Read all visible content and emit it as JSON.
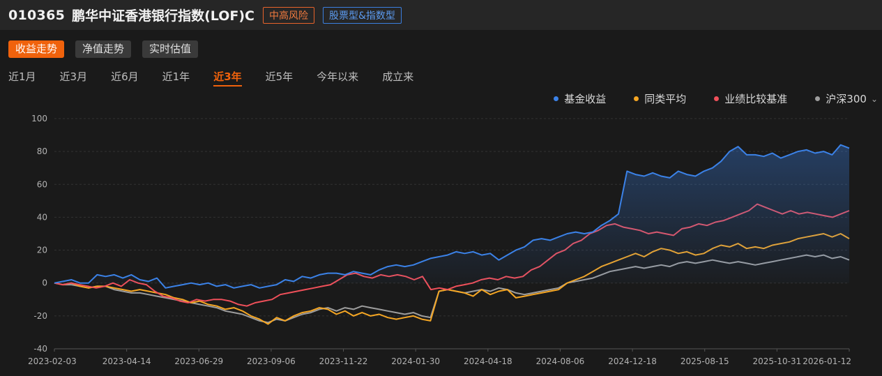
{
  "header": {
    "fund_code": "010365",
    "fund_name": "鹏华中证香港银行指数(LOF)C",
    "risk_tag": "中高风险",
    "type_tag": "股票型&指数型"
  },
  "mode_tabs": [
    {
      "label": "收益走势",
      "active": true
    },
    {
      "label": "净值走势",
      "active": false
    },
    {
      "label": "实时估值",
      "active": false
    }
  ],
  "range_tabs": [
    {
      "label": "近1月",
      "active": false
    },
    {
      "label": "近3月",
      "active": false
    },
    {
      "label": "近6月",
      "active": false
    },
    {
      "label": "近1年",
      "active": false
    },
    {
      "label": "近3年",
      "active": true
    },
    {
      "label": "近5年",
      "active": false
    },
    {
      "label": "今年以来",
      "active": false
    },
    {
      "label": "成立来",
      "active": false
    }
  ],
  "legend": [
    {
      "name": "基金收益",
      "color": "#3b82e8"
    },
    {
      "name": "同类平均",
      "color": "#f5a623"
    },
    {
      "name": "业绩比较基准",
      "color": "#f0505a"
    },
    {
      "name": "沪深300",
      "color": "#9e9e9e",
      "dropdown_icon": "chevron-down-icon"
    }
  ],
  "chart_data": {
    "type": "line",
    "x_tick_labels": [
      "2023-02-03",
      "2023-04-14",
      "2023-06-29",
      "2023-09-06",
      "2023-11-22",
      "2024-01-30",
      "2024-04-18",
      "2024-08-06",
      "2024-12-18",
      "2025-08-15",
      "2025-10-31",
      "2026-01-12"
    ],
    "ylim": [
      -40,
      100
    ],
    "y_ticks": [
      -40,
      -20,
      0,
      20,
      40,
      60,
      80,
      100
    ],
    "grid": true,
    "legend_position": "top-right",
    "series": [
      {
        "name": "基金收益",
        "color": "#3b82e8",
        "area_fill": true,
        "values": [
          0,
          1,
          2,
          0,
          0,
          5,
          4,
          5,
          3,
          5,
          2,
          1,
          3,
          -3,
          -2,
          -1,
          0,
          -1,
          0,
          -2,
          -1,
          -3,
          -2,
          -1,
          -3,
          -2,
          -1,
          2,
          1,
          4,
          3,
          5,
          6,
          6,
          5,
          7,
          6,
          5,
          8,
          10,
          11,
          10,
          11,
          13,
          15,
          16,
          17,
          19,
          18,
          19,
          17,
          18,
          14,
          17,
          20,
          22,
          26,
          27,
          26,
          28,
          30,
          31,
          30,
          31,
          35,
          38,
          42,
          68,
          66,
          65,
          67,
          65,
          64,
          68,
          66,
          65,
          68,
          70,
          74,
          80,
          83,
          78,
          78,
          77,
          79,
          76,
          78,
          80,
          81,
          79,
          80,
          78,
          84,
          82
        ]
      },
      {
        "name": "同类平均",
        "color": "#f5a623",
        "values": [
          0,
          -1,
          0,
          -2,
          -3,
          -2,
          -2,
          -3,
          -4,
          -5,
          -4,
          -5,
          -6,
          -7,
          -9,
          -10,
          -12,
          -11,
          -13,
          -14,
          -16,
          -15,
          -17,
          -20,
          -22,
          -25,
          -21,
          -23,
          -20,
          -18,
          -17,
          -15,
          -16,
          -19,
          -17,
          -20,
          -18,
          -20,
          -19,
          -21,
          -22,
          -21,
          -20,
          -22,
          -23,
          -5,
          -4,
          -5,
          -6,
          -8,
          -4,
          -7,
          -5,
          -4,
          -9,
          -8,
          -7,
          -6,
          -5,
          -4,
          0,
          2,
          4,
          7,
          10,
          12,
          14,
          16,
          18,
          16,
          19,
          21,
          20,
          18,
          19,
          17,
          18,
          21,
          23,
          22,
          24,
          21,
          22,
          21,
          23,
          24,
          25,
          27,
          28,
          29,
          30,
          28,
          30,
          27
        ]
      },
      {
        "name": "业绩比较基准",
        "color": "#f0505a",
        "values": [
          0,
          -1,
          0,
          -1,
          -2,
          -3,
          -2,
          0,
          -2,
          2,
          0,
          -1,
          -5,
          -8,
          -9,
          -11,
          -12,
          -10,
          -11,
          -10,
          -10,
          -11,
          -13,
          -14,
          -12,
          -11,
          -10,
          -7,
          -6,
          -5,
          -4,
          -3,
          -2,
          -1,
          2,
          5,
          6,
          4,
          3,
          5,
          4,
          5,
          4,
          2,
          4,
          -4,
          -3,
          -4,
          -2,
          -1,
          0,
          2,
          3,
          2,
          4,
          3,
          4,
          8,
          10,
          14,
          18,
          20,
          24,
          26,
          30,
          32,
          35,
          36,
          34,
          33,
          32,
          30,
          31,
          30,
          29,
          33,
          34,
          36,
          35,
          37,
          38,
          40,
          42,
          44,
          48,
          46,
          44,
          42,
          44,
          42,
          43,
          42,
          41,
          40,
          42,
          44
        ]
      },
      {
        "name": "沪深300",
        "color": "#9e9e9e",
        "values": [
          0,
          -1,
          -1,
          -2,
          -3,
          -2,
          -2,
          -4,
          -5,
          -6,
          -6,
          -7,
          -8,
          -9,
          -10,
          -11,
          -12,
          -13,
          -14,
          -15,
          -17,
          -18,
          -19,
          -21,
          -23,
          -24,
          -22,
          -23,
          -21,
          -19,
          -18,
          -16,
          -15,
          -17,
          -15,
          -16,
          -14,
          -15,
          -16,
          -17,
          -18,
          -19,
          -18,
          -20,
          -21,
          -5,
          -4,
          -5,
          -6,
          -5,
          -4,
          -5,
          -3,
          -4,
          -6,
          -7,
          -6,
          -5,
          -4,
          -3,
          0,
          1,
          2,
          3,
          5,
          7,
          8,
          9,
          10,
          9,
          10,
          11,
          10,
          12,
          13,
          12,
          13,
          14,
          13,
          12,
          13,
          12,
          11,
          12,
          13,
          14,
          15,
          16,
          17,
          16,
          17,
          15,
          16,
          14
        ]
      }
    ]
  }
}
